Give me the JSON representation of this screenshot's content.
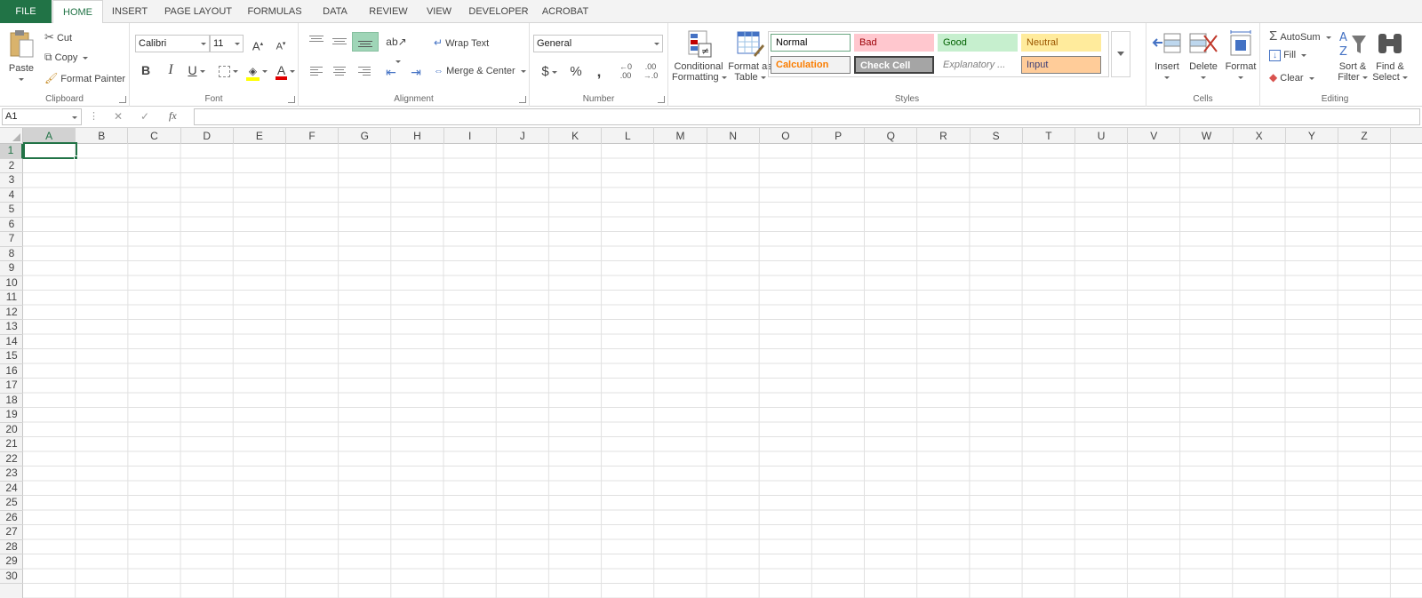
{
  "tabs": [
    "FILE",
    "HOME",
    "INSERT",
    "PAGE LAYOUT",
    "FORMULAS",
    "DATA",
    "REVIEW",
    "VIEW",
    "DEVELOPER",
    "ACROBAT"
  ],
  "clipboard": {
    "paste": "Paste",
    "cut": "Cut",
    "copy": "Copy",
    "format_painter": "Format Painter",
    "label": "Clipboard"
  },
  "font": {
    "name": "Calibri",
    "size": "11",
    "bold": "B",
    "italic": "I",
    "underline": "U",
    "grow": "A",
    "shrink": "A",
    "color_a": "A",
    "label": "Font"
  },
  "alignment": {
    "wrap_text": "Wrap Text",
    "merge_center": "Merge & Center",
    "label": "Alignment"
  },
  "number": {
    "format": "General",
    "currency": "$",
    "percent": "%",
    "comma": ",",
    "inc_decimal_top": "←0",
    "inc_decimal_bottom": ".00",
    "dec_decimal_top": ".00",
    "dec_decimal_bottom": "→.0",
    "label": "Number"
  },
  "styles": {
    "conditional_line1": "Conditional",
    "conditional_line2": "Formatting",
    "format_table_line1": "Format as",
    "format_table_line2": "Table",
    "cells": [
      {
        "label": "Normal",
        "bg": "#ffffff",
        "fg": "#000000",
        "border": "#6aa781"
      },
      {
        "label": "Bad",
        "bg": "#ffc7ce",
        "fg": "#9c0006",
        "border": "#ffc7ce"
      },
      {
        "label": "Good",
        "bg": "#c6efce",
        "fg": "#006100",
        "border": "#c6efce"
      },
      {
        "label": "Neutral",
        "bg": "#ffeb9c",
        "fg": "#9c5700",
        "border": "#ffeb9c"
      },
      {
        "label": "Calculation",
        "bg": "#f2f2f2",
        "fg": "#fa7d00",
        "border": "#7f7f7f"
      },
      {
        "label": "Check Cell",
        "bg": "#a5a5a5",
        "fg": "#ffffff",
        "border": "#3f3f3f"
      },
      {
        "label": "Explanatory ...",
        "bg": "#ffffff",
        "fg": "#7f7f7f",
        "border": "#ffffff"
      },
      {
        "label": "Input",
        "bg": "#ffcc99",
        "fg": "#3f3f76",
        "border": "#7f7f7f"
      }
    ],
    "label": "Styles"
  },
  "cells_group": {
    "insert": "Insert",
    "delete": "Delete",
    "format": "Format",
    "label": "Cells"
  },
  "editing": {
    "autosum": "AutoSum",
    "fill": "Fill",
    "clear": "Clear",
    "sort_line1": "Sort &",
    "sort_line2": "Filter",
    "find_line1": "Find &",
    "find_line2": "Select",
    "label": "Editing"
  },
  "formula_bar": {
    "name_box": "A1",
    "fx": "fx",
    "cancel": "✕",
    "enter": "✓",
    "more": "⋮"
  },
  "columns": [
    "A",
    "B",
    "C",
    "D",
    "E",
    "F",
    "G",
    "H",
    "I",
    "J",
    "K",
    "L",
    "M",
    "N",
    "O",
    "P",
    "Q",
    "R",
    "S",
    "T",
    "U",
    "V",
    "W",
    "X",
    "Y",
    "Z"
  ],
  "rows": [
    "1",
    "2",
    "3",
    "4",
    "5",
    "6",
    "7",
    "8",
    "9",
    "10",
    "11",
    "12",
    "13",
    "14",
    "15",
    "16",
    "17",
    "18",
    "19",
    "20",
    "21",
    "22",
    "23",
    "24",
    "25",
    "26",
    "27",
    "28",
    "29",
    "30"
  ],
  "selected_cell": {
    "col": "A",
    "row": "1"
  },
  "accent_color": "#217346"
}
